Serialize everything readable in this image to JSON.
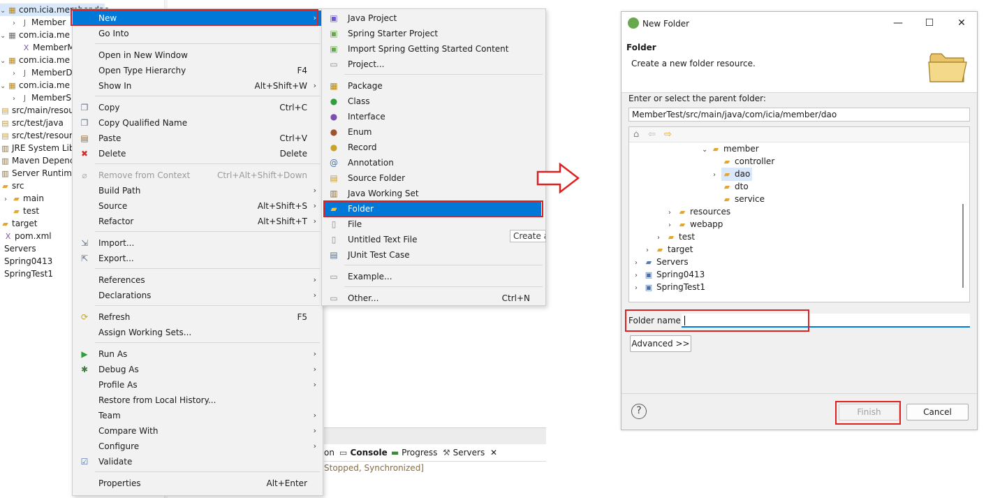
{
  "explorer": {
    "items": [
      {
        "label": "com.icia.member.dao",
        "icon": "package-icon"
      },
      {
        "label": "Member",
        "icon": "java-file-icon"
      },
      {
        "label": "com.icia.me",
        "icon": "package-icon"
      },
      {
        "label": "MemberM",
        "icon": "xml-file-icon"
      },
      {
        "label": "com.icia.me",
        "icon": "package-icon"
      },
      {
        "label": "MemberD",
        "icon": "java-file-icon"
      },
      {
        "label": "com.icia.me",
        "icon": "package-icon"
      },
      {
        "label": "MemberS",
        "icon": "java-file-icon"
      },
      {
        "label": "src/main/resou",
        "icon": "source-folder-icon"
      },
      {
        "label": "src/test/java",
        "icon": "source-folder-icon"
      },
      {
        "label": "src/test/resourc",
        "icon": "source-folder-icon"
      },
      {
        "label": "JRE System Lib",
        "icon": "library-icon"
      },
      {
        "label": "Maven Depenc",
        "icon": "library-icon"
      },
      {
        "label": "Server Runtime",
        "icon": "library-icon"
      },
      {
        "label": "src",
        "icon": "folder-icon"
      },
      {
        "label": "main",
        "icon": "folder-icon"
      },
      {
        "label": "test",
        "icon": "folder-icon"
      },
      {
        "label": "target",
        "icon": "folder-icon"
      },
      {
        "label": "pom.xml",
        "icon": "xml-file-icon"
      },
      {
        "label": "Servers",
        "icon": "none"
      },
      {
        "label": "Spring0413",
        "icon": "none"
      },
      {
        "label": "SpringTest1",
        "icon": "none"
      }
    ]
  },
  "context_menu": {
    "items": [
      {
        "label": "New",
        "shortcut": "",
        "submenu": true
      },
      {
        "label": "Go Into",
        "shortcut": ""
      },
      {
        "label": "Open in New Window",
        "shortcut": ""
      },
      {
        "label": "Open Type Hierarchy",
        "shortcut": "F4"
      },
      {
        "label": "Show In",
        "shortcut": "Alt+Shift+W",
        "submenu": true
      },
      {
        "label": "Copy",
        "shortcut": "Ctrl+C",
        "icon": "copy-icon"
      },
      {
        "label": "Copy Qualified Name",
        "shortcut": "",
        "icon": "copy-icon"
      },
      {
        "label": "Paste",
        "shortcut": "Ctrl+V",
        "icon": "paste-icon"
      },
      {
        "label": "Delete",
        "shortcut": "Delete",
        "icon": "delete-icon"
      },
      {
        "label": "Remove from Context",
        "shortcut": "Ctrl+Alt+Shift+Down",
        "disabled": true
      },
      {
        "label": "Build Path",
        "shortcut": "",
        "submenu": true
      },
      {
        "label": "Source",
        "shortcut": "Alt+Shift+S",
        "submenu": true
      },
      {
        "label": "Refactor",
        "shortcut": "Alt+Shift+T",
        "submenu": true
      },
      {
        "label": "Import...",
        "shortcut": "",
        "icon": "import-icon"
      },
      {
        "label": "Export...",
        "shortcut": "",
        "icon": "export-icon"
      },
      {
        "label": "References",
        "shortcut": "",
        "submenu": true
      },
      {
        "label": "Declarations",
        "shortcut": "",
        "submenu": true
      },
      {
        "label": "Refresh",
        "shortcut": "F5",
        "icon": "refresh-icon"
      },
      {
        "label": "Assign Working Sets...",
        "shortcut": ""
      },
      {
        "label": "Run As",
        "shortcut": "",
        "submenu": true,
        "icon": "run-icon"
      },
      {
        "label": "Debug As",
        "shortcut": "",
        "submenu": true,
        "icon": "debug-icon"
      },
      {
        "label": "Profile As",
        "shortcut": "",
        "submenu": true
      },
      {
        "label": "Restore from Local History...",
        "shortcut": ""
      },
      {
        "label": "Team",
        "shortcut": "",
        "submenu": true
      },
      {
        "label": "Compare With",
        "shortcut": "",
        "submenu": true
      },
      {
        "label": "Configure",
        "shortcut": "",
        "submenu": true
      },
      {
        "label": "Validate",
        "shortcut": "",
        "icon": "check-icon"
      },
      {
        "label": "Properties",
        "shortcut": "Alt+Enter"
      }
    ]
  },
  "submenu": {
    "items": [
      {
        "label": "Java Project",
        "shortcut": ""
      },
      {
        "label": "Spring Starter Project",
        "shortcut": ""
      },
      {
        "label": "Import Spring Getting Started Content",
        "shortcut": ""
      },
      {
        "label": "Project...",
        "shortcut": ""
      },
      {
        "label": "Package",
        "shortcut": ""
      },
      {
        "label": "Class",
        "shortcut": ""
      },
      {
        "label": "Interface",
        "shortcut": ""
      },
      {
        "label": "Enum",
        "shortcut": ""
      },
      {
        "label": "Record",
        "shortcut": ""
      },
      {
        "label": "Annotation",
        "shortcut": ""
      },
      {
        "label": "Source Folder",
        "shortcut": ""
      },
      {
        "label": "Java Working Set",
        "shortcut": ""
      },
      {
        "label": "Folder",
        "shortcut": ""
      },
      {
        "label": "File",
        "shortcut": ""
      },
      {
        "label": "Untitled Text File",
        "shortcut": ""
      },
      {
        "label": "JUnit Test Case",
        "shortcut": ""
      },
      {
        "label": "Example...",
        "shortcut": ""
      },
      {
        "label": "Other...",
        "shortcut": "Ctrl+N"
      }
    ],
    "tooltip": "Create a"
  },
  "console": {
    "tab_partial": "on",
    "tab_console": "Console",
    "tab_progress": "Progress",
    "tab_servers": "Servers",
    "status": "Stopped, Synchronized]"
  },
  "dialog": {
    "title": "New Folder",
    "header_title": "Folder",
    "header_desc": "Create a new folder resource.",
    "parent_label": "Enter or select the parent folder:",
    "parent_value": "MemberTest/src/main/java/com/icia/member/dao",
    "tree": [
      {
        "label": "member"
      },
      {
        "label": "controller"
      },
      {
        "label": "dao"
      },
      {
        "label": "dto"
      },
      {
        "label": "service"
      },
      {
        "label": "resources"
      },
      {
        "label": "webapp"
      },
      {
        "label": "test"
      },
      {
        "label": "target"
      },
      {
        "label": "Servers"
      },
      {
        "label": "Spring0413"
      },
      {
        "label": "SpringTest1"
      }
    ],
    "folder_name_label": "Folder name:",
    "folder_name_value": "",
    "advanced_label": "Advanced >>",
    "finish_label": "Finish",
    "cancel_label": "Cancel",
    "help_glyph": "?",
    "minimize_glyph": "—",
    "maximize_glyph": "☐",
    "close_glyph": "✕"
  },
  "colors": {
    "highlight": "#0078d7",
    "annotation_red": "#e02020",
    "folder": "#e3a72f"
  }
}
